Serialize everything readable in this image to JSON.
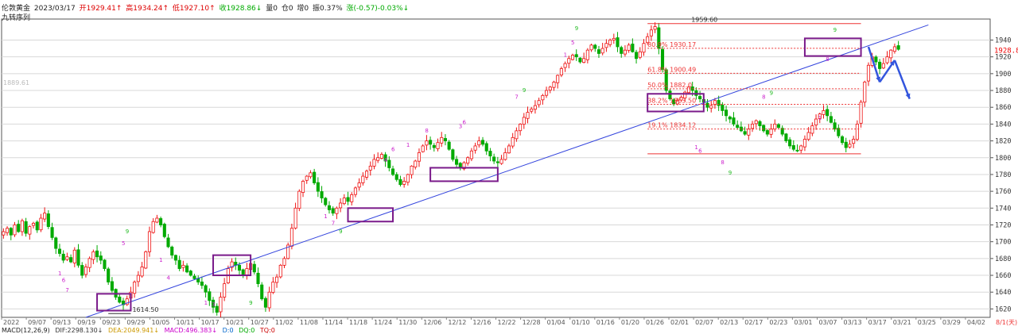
{
  "header": {
    "symbol": "伦敦黄金",
    "date": "2023/03/17",
    "open": "开1929.41↑",
    "high": "高1934.24↑",
    "low": "低1927.10↑",
    "close": "收1928.86↓",
    "volume": "量0",
    "oi": "仓0",
    "increase": "增0",
    "amplitude": "振0.37%",
    "change": "涨(-0.57)-0.03%↓",
    "indicator": "九转序列"
  },
  "footer": {
    "macd": "MACD(12,26,9)",
    "dif": "DIF:2298.130↓",
    "dea": "DEA:2049.941↓",
    "macd_val": "MACD:496.383↓",
    "d": "D:0",
    "dq": "DQ:0",
    "tq": "TQ:0",
    "corner": "8/1(天)"
  },
  "chart_data": {
    "type": "candlestick",
    "ylim": [
      1610,
      1965
    ],
    "yticks": [
      1620,
      1640,
      1660,
      1680,
      1700,
      1720,
      1740,
      1760,
      1780,
      1800,
      1820,
      1840,
      1860,
      1880,
      1900,
      1920,
      1940
    ],
    "xlabels": [
      "2022",
      "09/07",
      "09/13",
      "09/19",
      "09/23",
      "09/29",
      "10/05",
      "10/11",
      "10/17",
      "10/21",
      "10/27",
      "11/02",
      "11/08",
      "11/14",
      "11/18",
      "11/24",
      "11/30",
      "12/06",
      "12/12",
      "12/16",
      "12/22",
      "12/28",
      "01/04",
      "01/10",
      "01/16",
      "01/20",
      "01/26",
      "02/01",
      "02/07",
      "02/13",
      "02/17",
      "02/23",
      "03/01",
      "03/07",
      "03/13",
      "03/17",
      "03/21",
      "03/25",
      "03/29",
      "04/02"
    ],
    "price_marker": "1889.61",
    "last_price": "1928.86",
    "close_path": [
      1712,
      1716,
      1708,
      1720,
      1712,
      1725,
      1710,
      1718,
      1722,
      1714,
      1728,
      1734,
      1718,
      1705,
      1692,
      1686,
      1678,
      1682,
      1676,
      1690,
      1672,
      1660,
      1670,
      1680,
      1688,
      1682,
      1678,
      1668,
      1652,
      1642,
      1634,
      1628,
      1625,
      1632,
      1640,
      1652,
      1660,
      1670,
      1688,
      1712,
      1724,
      1728,
      1720,
      1706,
      1694,
      1684,
      1678,
      1668,
      1672,
      1664,
      1660,
      1656,
      1652,
      1648,
      1640,
      1630,
      1622,
      1616,
      1634,
      1650,
      1668,
      1676,
      1672,
      1666,
      1660,
      1668,
      1674,
      1664,
      1650,
      1632,
      1622,
      1640,
      1652,
      1658,
      1672,
      1680,
      1696,
      1716,
      1740,
      1760,
      1772,
      1778,
      1782,
      1770,
      1760,
      1752,
      1744,
      1738,
      1734,
      1740,
      1746,
      1752,
      1748,
      1756,
      1764,
      1770,
      1778,
      1784,
      1790,
      1798,
      1800,
      1804,
      1796,
      1788,
      1780,
      1774,
      1768,
      1772,
      1780,
      1790,
      1796,
      1806,
      1814,
      1820,
      1816,
      1812,
      1818,
      1824,
      1820,
      1810,
      1798,
      1792,
      1788,
      1794,
      1800,
      1808,
      1814,
      1820,
      1816,
      1808,
      1802,
      1796,
      1794,
      1798,
      1806,
      1814,
      1824,
      1832,
      1840,
      1848,
      1854,
      1858,
      1862,
      1868,
      1874,
      1880,
      1884,
      1890,
      1898,
      1906,
      1912,
      1918,
      1922,
      1920,
      1914,
      1918,
      1928,
      1934,
      1930,
      1924,
      1930,
      1936,
      1940,
      1942,
      1932,
      1924,
      1928,
      1934,
      1926,
      1918,
      1926,
      1936,
      1944,
      1952,
      1956,
      1930,
      1905,
      1880,
      1870,
      1864,
      1868,
      1872,
      1878,
      1884,
      1880,
      1874,
      1870,
      1866,
      1860,
      1862,
      1868,
      1862,
      1856,
      1850,
      1846,
      1840,
      1836,
      1832,
      1828,
      1834,
      1840,
      1844,
      1838,
      1832,
      1828,
      1834,
      1840,
      1836,
      1828,
      1820,
      1814,
      1810,
      1808,
      1814,
      1822,
      1830,
      1838,
      1846,
      1852,
      1856,
      1850,
      1842,
      1834,
      1826,
      1818,
      1812,
      1816,
      1822,
      1840,
      1866,
      1890,
      1910,
      1920,
      1914,
      1906,
      1912,
      1920,
      1928,
      1932,
      1929
    ],
    "fib_levels": [
      {
        "label": "1959.60",
        "value": 1959.6,
        "solid": true
      },
      {
        "label": "80.9% 1930.17",
        "value": 1930.17,
        "solid": false
      },
      {
        "label": "61.8% 1900.49",
        "value": 1900.49,
        "solid": false
      },
      {
        "label": "50.0% 1882.0",
        "value": 1882.0,
        "solid": false
      },
      {
        "label": "38.2% 1863.50",
        "value": 1863.5,
        "solid": false
      },
      {
        "label": "19.1% 1834.12",
        "value": 1834.12,
        "solid": false
      },
      {
        "label": "",
        "value": 1804.6,
        "solid": true
      }
    ],
    "low_label": "1614.50",
    "trendline": [
      1610,
      1958
    ],
    "boxes": [
      {
        "i0": 25,
        "i1": 34,
        "lo": 1618,
        "hi": 1638
      },
      {
        "i0": 56,
        "i1": 66,
        "lo": 1660,
        "hi": 1684
      },
      {
        "i0": 92,
        "i1": 104,
        "lo": 1724,
        "hi": 1740
      },
      {
        "i0": 114,
        "i1": 132,
        "lo": 1772,
        "hi": 1788
      },
      {
        "i0": 172,
        "i1": 187,
        "lo": 1855,
        "hi": 1876
      },
      {
        "i0": 214,
        "i1": 229,
        "lo": 1921,
        "hi": 1942
      }
    ],
    "nine_labels": [
      {
        "i": 15,
        "v": 1660,
        "t": "1"
      },
      {
        "i": 16,
        "v": 1652,
        "t": "6"
      },
      {
        "i": 17,
        "v": 1640,
        "t": "7"
      },
      {
        "i": 32,
        "v": 1696,
        "t": "5"
      },
      {
        "i": 33,
        "v": 1710,
        "t": "9"
      },
      {
        "i": 42,
        "v": 1676,
        "t": "1"
      },
      {
        "i": 44,
        "v": 1655,
        "t": "4"
      },
      {
        "i": 54,
        "v": 1625,
        "t": "1"
      },
      {
        "i": 56,
        "v": 1623,
        "t": "3"
      },
      {
        "i": 66,
        "v": 1625,
        "t": "9"
      },
      {
        "i": 86,
        "v": 1728,
        "t": "1"
      },
      {
        "i": 88,
        "v": 1720,
        "t": "7"
      },
      {
        "i": 90,
        "v": 1710,
        "t": "9"
      },
      {
        "i": 102,
        "v": 1795,
        "t": "4"
      },
      {
        "i": 104,
        "v": 1808,
        "t": "6"
      },
      {
        "i": 108,
        "v": 1813,
        "t": "1"
      },
      {
        "i": 113,
        "v": 1830,
        "t": "8"
      },
      {
        "i": 122,
        "v": 1835,
        "t": "3"
      },
      {
        "i": 123,
        "v": 1840,
        "t": "6"
      },
      {
        "i": 137,
        "v": 1870,
        "t": "7"
      },
      {
        "i": 139,
        "v": 1878,
        "t": "9"
      },
      {
        "i": 150,
        "v": 1920,
        "t": "1"
      },
      {
        "i": 152,
        "v": 1935,
        "t": "5"
      },
      {
        "i": 153,
        "v": 1952,
        "t": "9"
      },
      {
        "i": 185,
        "v": 1810,
        "t": "1"
      },
      {
        "i": 186,
        "v": 1806,
        "t": "6"
      },
      {
        "i": 192,
        "v": 1792,
        "t": "8"
      },
      {
        "i": 194,
        "v": 1780,
        "t": "9"
      },
      {
        "i": 203,
        "v": 1870,
        "t": "8"
      },
      {
        "i": 205,
        "v": 1875,
        "t": "9"
      },
      {
        "i": 218,
        "v": 1845,
        "t": "1"
      },
      {
        "i": 220,
        "v": 1915,
        "t": "8"
      },
      {
        "i": 222,
        "v": 1950,
        "t": "9"
      }
    ],
    "arrows": [
      {
        "from": [
          231,
          1932
        ],
        "to": [
          234,
          1890
        ]
      },
      {
        "from": [
          234,
          1890
        ],
        "to": [
          238,
          1916
        ]
      },
      {
        "from": [
          238,
          1916
        ],
        "to": [
          242,
          1870
        ]
      }
    ]
  }
}
